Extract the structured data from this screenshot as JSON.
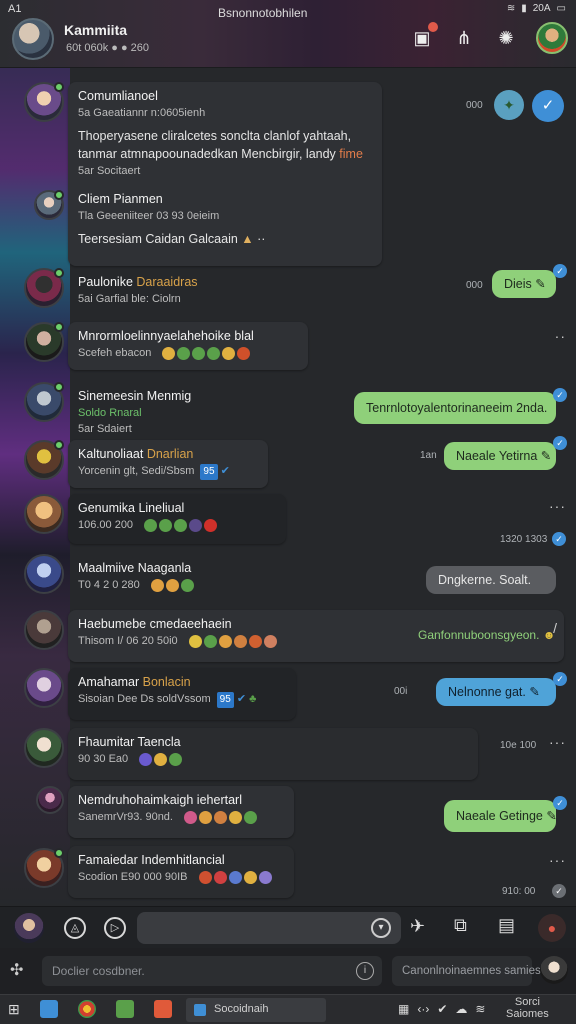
{
  "status": {
    "left": "A1",
    "center": "Bsnonnotobhilen",
    "right": "20A"
  },
  "header": {
    "title": "Kammiita",
    "subtitle": "60t 060k ● ● 260",
    "icons": [
      "store-icon",
      "share-icon",
      "settings-icon",
      "profile-avatar"
    ]
  },
  "messages": [
    {
      "name": "Comumlianoel",
      "meta": "5a Gaeatiannr n:0605ienh",
      "body": "Thoperyasene cliralcetes sonclta clanlof yahtaah, tanmar atmnapoounadedkan Mencbirgir, landy",
      "highlight": "fime",
      "name2": "Cliem Pianmen",
      "meta2": "Tla Geeeniiteer 03 93 0eieim",
      "body2": "Teersesiam Caidan Galcaain",
      "sub": "5ar Socitaert",
      "right_time": "000",
      "right_badge": "plugin-icon"
    },
    {
      "name": "Paulonike",
      "name_accent": "Daraaidras",
      "meta": "5ai Garfial ble: Ciolrn",
      "right_time": "000",
      "reply": "Dieis"
    },
    {
      "name": "Mnrormloelinnyaelahehoike blal",
      "meta": "Scefeh ebacon"
    },
    {
      "name": "Sinemeesin Menmig",
      "meta": "Soldo Rnaral",
      "meta2": "5ar Sdaiert",
      "reply": "Tenrnlotoyalentorinaneeim 2nda."
    },
    {
      "name": "Kaltunoliaat",
      "name_accent": "Dnarlian",
      "meta": "Yorcenin glt, Sedi/Sbsm",
      "tag": "95",
      "time": "1an",
      "reply": "Naeale Yetirna"
    },
    {
      "name": "Genumika Lineliual",
      "meta": "106.00 200",
      "time": "1320 1303"
    },
    {
      "name": "Maalmiive Naaganla",
      "meta": "T0 4 2 0 280",
      "reply": "Dngkerne. Soalt."
    },
    {
      "name": "Haebumebe cmedaeehaein",
      "meta": "Thisom I/ 06 20 50i0",
      "reply": "Ganfonnuboonsgyeon."
    },
    {
      "name": "Amahamar",
      "name_accent": "Bonlacin",
      "meta": "Sisoian Dee Ds soldVssom",
      "tag": "95",
      "time": "00i",
      "reply": "Nelnonne gat."
    },
    {
      "name": "Fhaumitar Taencla",
      "meta": "90 30 Ea0",
      "time": "10e 100"
    },
    {
      "name": "Nemdruhohaimkaigh iehertarl",
      "meta": "SanemrVr93. 90nd.",
      "reply": "Naeale Getinge"
    },
    {
      "name": "Famaiedar Indemhitlancial",
      "meta": "Scodion E90 000 90IB",
      "time": "910: 00"
    }
  ],
  "composer": {
    "placeholder": ""
  },
  "reply_bar": {
    "placeholder": "Doclier cosdbner.",
    "right_text": "Canonlnoinaemnes samies"
  },
  "taskbar": {
    "app_label": "Socoidnaih",
    "clock_top": "Sorci",
    "clock_bottom": "Saiomes"
  },
  "colors": {
    "green_bubble": "#8fd07a",
    "blue_bubble": "#4fa3d8",
    "grey_bubble": "#5a5c60",
    "accent": "#d8a24a"
  }
}
